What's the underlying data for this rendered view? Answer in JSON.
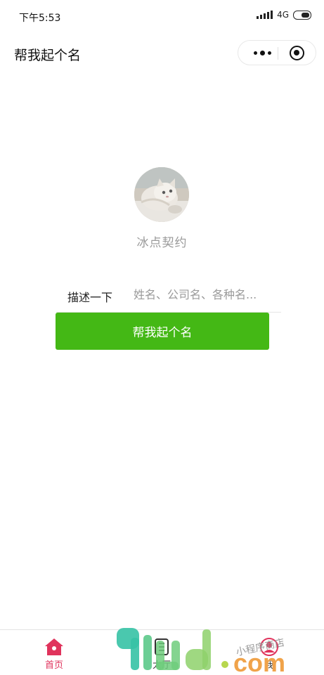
{
  "status_bar": {
    "time": "下午5:53",
    "network": "4G"
  },
  "nav": {
    "title": "帮我起个名"
  },
  "profile": {
    "name": "冰点契约"
  },
  "form": {
    "label": "描述一下",
    "placeholder": "姓名、公司名、各种名...",
    "submit_label": "帮我起个名"
  },
  "tabbar": {
    "items": [
      {
        "label": "首页",
        "icon": "home-icon",
        "active": true
      },
      {
        "label": "大厅",
        "icon": "hall-icon",
        "active": false
      },
      {
        "label": "我",
        "icon": "user-icon",
        "active": false
      }
    ]
  },
  "watermark": {
    "main": "9iud.com",
    "tagline": "小程序商店"
  },
  "colors": {
    "accent": "#44b815",
    "tab_active": "#e0335c",
    "muted_text": "#9a9a9a"
  }
}
